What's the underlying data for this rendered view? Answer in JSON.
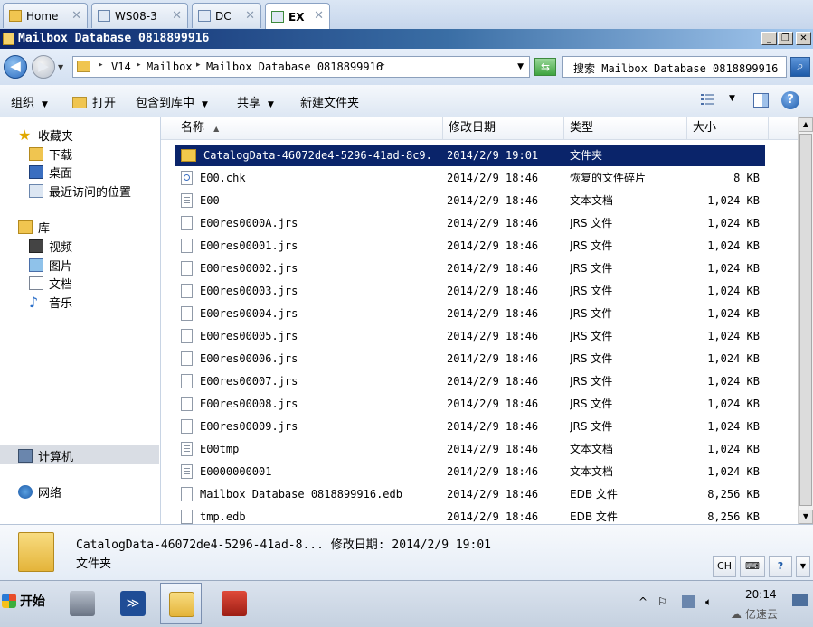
{
  "vm_tabs": [
    {
      "label": "Home"
    },
    {
      "label": "WS08-3"
    },
    {
      "label": "DC"
    },
    {
      "label": "EX"
    }
  ],
  "window": {
    "title": "Mailbox Database 0818899916"
  },
  "address": {
    "crumbs": [
      "V14",
      "Mailbox",
      "Mailbox Database 0818899916"
    ],
    "search_placeholder": "搜索 Mailbox Database 0818899916"
  },
  "toolbar": {
    "organize": "组织",
    "open": "打开",
    "include_in_library": "包含到库中",
    "share": "共享",
    "new_folder": "新建文件夹"
  },
  "nav": {
    "favorites": "收藏夹",
    "downloads": "下载",
    "desktop": "桌面",
    "recent": "最近访问的位置",
    "libraries": "库",
    "videos": "视频",
    "pictures": "图片",
    "documents": "文档",
    "music": "音乐",
    "computer": "计算机",
    "network": "网络"
  },
  "columns": {
    "name": "名称",
    "date": "修改日期",
    "type": "类型",
    "size": "大小"
  },
  "files": [
    {
      "name": "CatalogData-46072de4-5296-41ad-8c9...",
      "date": "2014/2/9 19:01",
      "type": "文件夹",
      "size": "",
      "icon": "folder"
    },
    {
      "name": "E00.chk",
      "date": "2014/2/9 18:46",
      "type": "恢复的文件碎片",
      "size": "8 KB",
      "icon": "chk"
    },
    {
      "name": "E00",
      "date": "2014/2/9 18:46",
      "type": "文本文档",
      "size": "1,024 KB",
      "icon": "txt"
    },
    {
      "name": "E00res0000A.jrs",
      "date": "2014/2/9 18:46",
      "type": "JRS 文件",
      "size": "1,024 KB",
      "icon": "file"
    },
    {
      "name": "E00res00001.jrs",
      "date": "2014/2/9 18:46",
      "type": "JRS 文件",
      "size": "1,024 KB",
      "icon": "file"
    },
    {
      "name": "E00res00002.jrs",
      "date": "2014/2/9 18:46",
      "type": "JRS 文件",
      "size": "1,024 KB",
      "icon": "file"
    },
    {
      "name": "E00res00003.jrs",
      "date": "2014/2/9 18:46",
      "type": "JRS 文件",
      "size": "1,024 KB",
      "icon": "file"
    },
    {
      "name": "E00res00004.jrs",
      "date": "2014/2/9 18:46",
      "type": "JRS 文件",
      "size": "1,024 KB",
      "icon": "file"
    },
    {
      "name": "E00res00005.jrs",
      "date": "2014/2/9 18:46",
      "type": "JRS 文件",
      "size": "1,024 KB",
      "icon": "file"
    },
    {
      "name": "E00res00006.jrs",
      "date": "2014/2/9 18:46",
      "type": "JRS 文件",
      "size": "1,024 KB",
      "icon": "file"
    },
    {
      "name": "E00res00007.jrs",
      "date": "2014/2/9 18:46",
      "type": "JRS 文件",
      "size": "1,024 KB",
      "icon": "file"
    },
    {
      "name": "E00res00008.jrs",
      "date": "2014/2/9 18:46",
      "type": "JRS 文件",
      "size": "1,024 KB",
      "icon": "file"
    },
    {
      "name": "E00res00009.jrs",
      "date": "2014/2/9 18:46",
      "type": "JRS 文件",
      "size": "1,024 KB",
      "icon": "file"
    },
    {
      "name": "E00tmp",
      "date": "2014/2/9 18:46",
      "type": "文本文档",
      "size": "1,024 KB",
      "icon": "txt"
    },
    {
      "name": "E0000000001",
      "date": "2014/2/9 18:46",
      "type": "文本文档",
      "size": "1,024 KB",
      "icon": "txt"
    },
    {
      "name": "Mailbox Database 0818899916.edb",
      "date": "2014/2/9 18:46",
      "type": "EDB 文件",
      "size": "8,256 KB",
      "icon": "file"
    },
    {
      "name": "tmp.edb",
      "date": "2014/2/9 18:46",
      "type": "EDB 文件",
      "size": "8,256 KB",
      "icon": "file"
    }
  ],
  "details": {
    "name_line": "CatalogData-46072de4-5296-41ad-8...  修改日期: 2014/2/9 19:01",
    "type_line": "文件夹"
  },
  "taskbar": {
    "start": "开始",
    "lang": "CH",
    "clock": "20:14"
  },
  "watermark": "亿速云",
  "colors": {
    "selection": "#0a246a",
    "title_bar": "#0a246a"
  }
}
